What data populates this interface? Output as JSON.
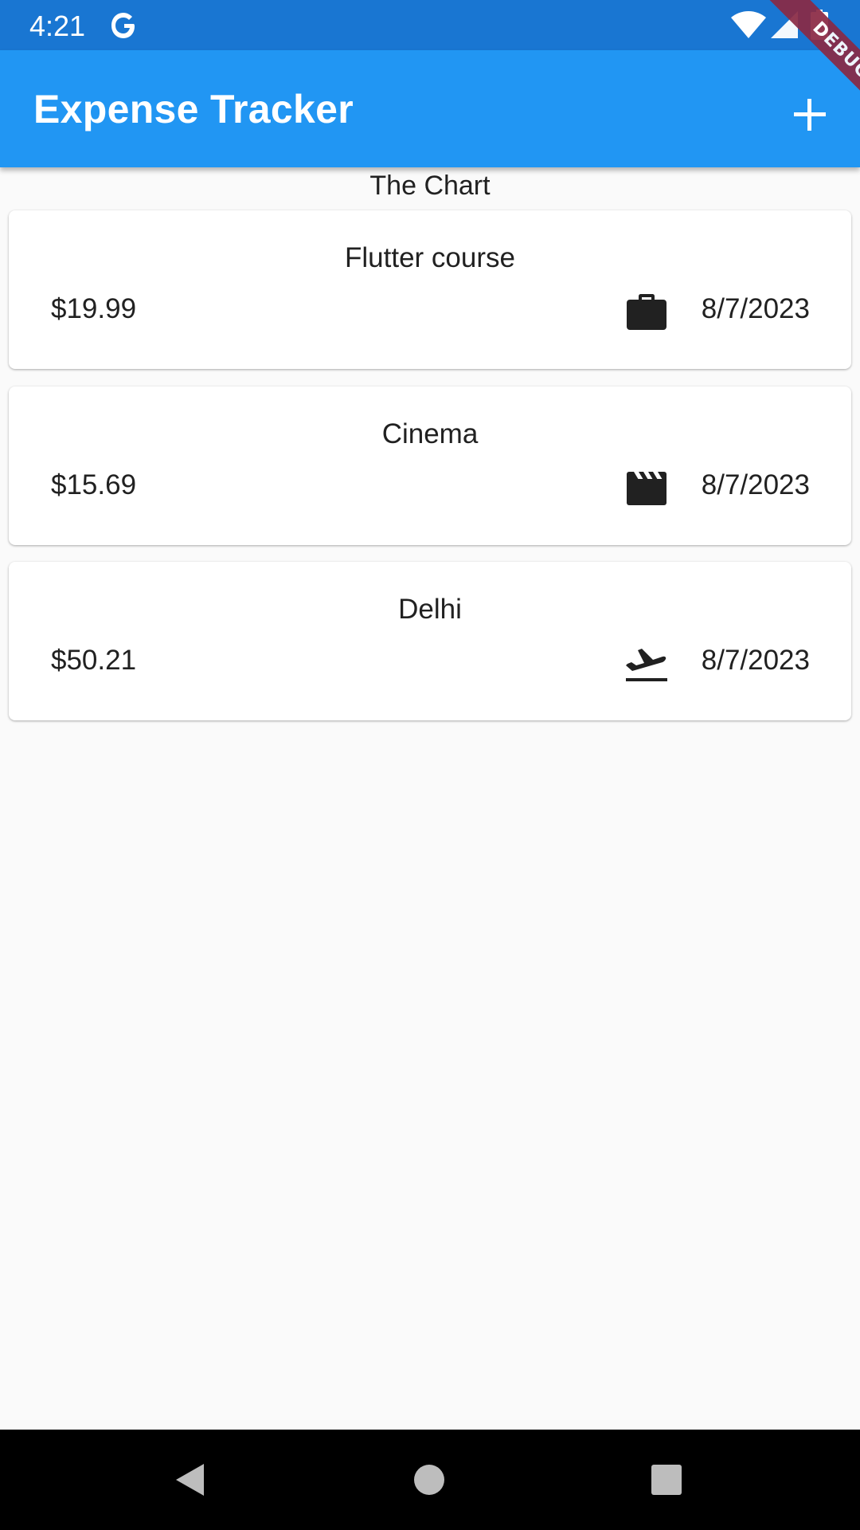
{
  "status_bar": {
    "time": "4:21",
    "g_logo": "G",
    "icons": [
      "google-icon",
      "wifi-icon",
      "signal-icon",
      "battery-icon"
    ]
  },
  "app_bar": {
    "title": "Expense Tracker",
    "add_icon": "plus-icon",
    "color": "#2196f3"
  },
  "debug_banner": "DEBUG",
  "chart_placeholder": "The Chart",
  "expenses": [
    {
      "title": "Flutter course",
      "amount": "$19.99",
      "category_icon": "briefcase-icon",
      "date": "8/7/2023"
    },
    {
      "title": "Cinema",
      "amount": "$15.69",
      "category_icon": "movie-clapper-icon",
      "date": "8/7/2023"
    },
    {
      "title": "Delhi",
      "amount": "$50.21",
      "category_icon": "flight-takeoff-icon",
      "date": "8/7/2023"
    }
  ],
  "nav_bar": {
    "buttons": [
      "back-icon",
      "home-icon",
      "recents-icon"
    ]
  }
}
